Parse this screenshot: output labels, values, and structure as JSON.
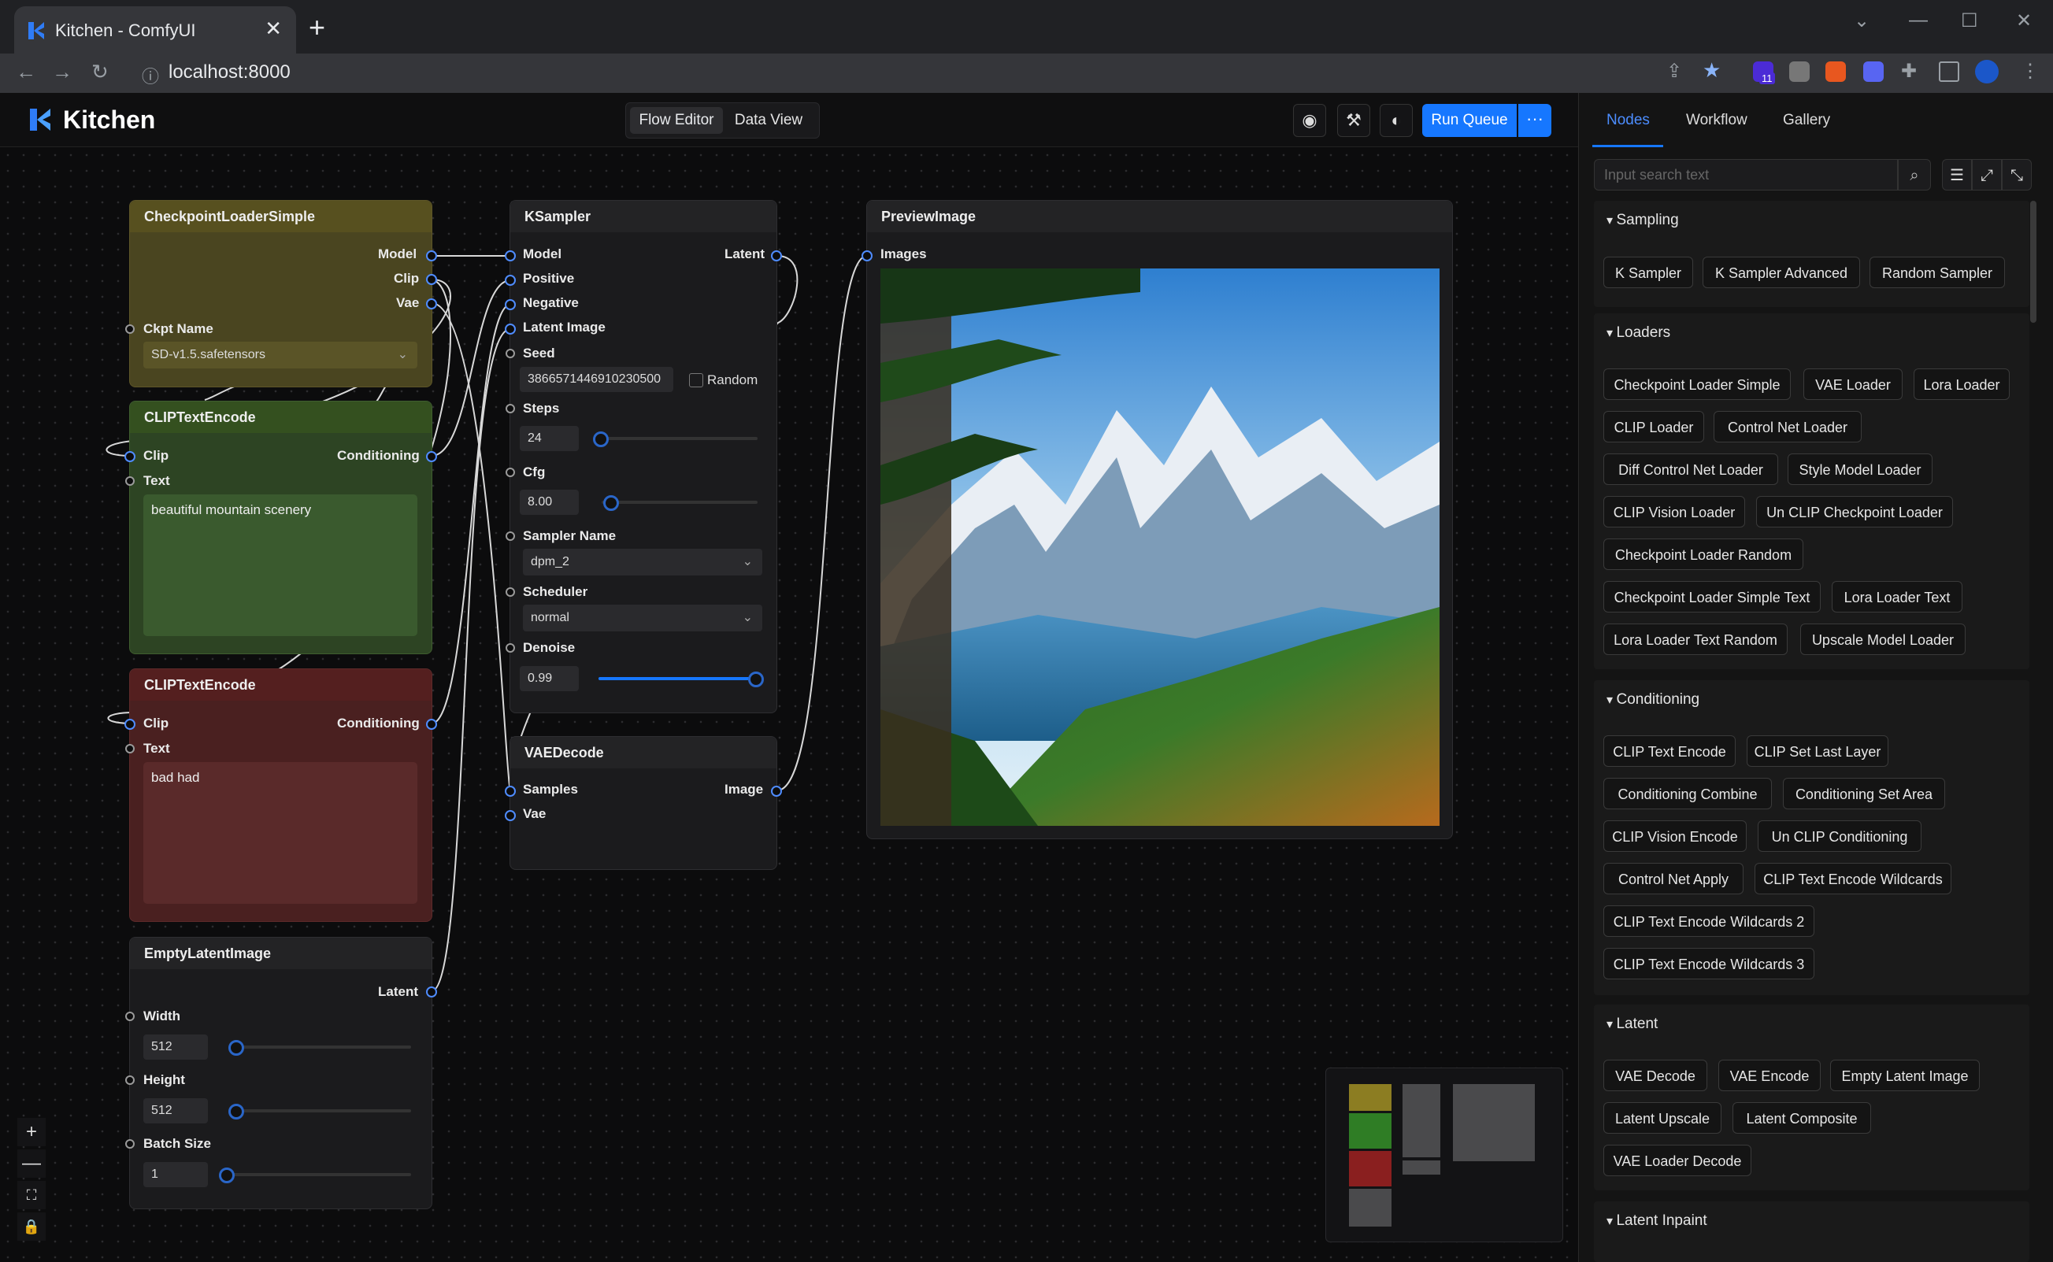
{
  "browser": {
    "tab_title": "Kitchen - ComfyUI",
    "tab_close": "✕",
    "new_tab": "+",
    "url": "localhost:8000",
    "extension_badge": "11"
  },
  "app": {
    "name": "Kitchen",
    "views": [
      "Flow Editor",
      "Data View"
    ],
    "run_queue": "Run Queue",
    "run_more": "···"
  },
  "nodes": {
    "checkpoint": {
      "title": "CheckpointLoaderSimple",
      "outputs": [
        "Model",
        "Clip",
        "Vae"
      ],
      "ckpt_label": "Ckpt Name",
      "ckpt_value": "SD-v1.5.safetensors"
    },
    "clip_pos": {
      "title": "CLIPTextEncode",
      "input": "Clip",
      "output": "Conditioning",
      "text_label": "Text",
      "text": "beautiful mountain scenery"
    },
    "clip_neg": {
      "title": "CLIPTextEncode",
      "input": "Clip",
      "output": "Conditioning",
      "text_label": "Text",
      "text": "bad had"
    },
    "empty_latent": {
      "title": "EmptyLatentImage",
      "output": "Latent",
      "width_label": "Width",
      "width": "512",
      "height_label": "Height",
      "height": "512",
      "batch_label": "Batch Size",
      "batch": "1"
    },
    "ksampler": {
      "title": "KSampler",
      "inputs": [
        "Model",
        "Positive",
        "Negative",
        "Latent Image"
      ],
      "output": "Latent",
      "seed_label": "Seed",
      "seed": "3866571446910230500",
      "random_label": "Random",
      "steps_label": "Steps",
      "steps": "24",
      "cfg_label": "Cfg",
      "cfg": "8.00",
      "sampler_label": "Sampler Name",
      "sampler": "dpm_2",
      "scheduler_label": "Scheduler",
      "scheduler": "normal",
      "denoise_label": "Denoise",
      "denoise": "0.99"
    },
    "vae_decode": {
      "title": "VAEDecode",
      "inputs": [
        "Samples",
        "Vae"
      ],
      "output": "Image"
    },
    "preview": {
      "title": "PreviewImage",
      "input": "Images"
    }
  },
  "panel": {
    "tabs": [
      "Nodes",
      "Workflow",
      "Gallery"
    ],
    "search_placeholder": "Input search text",
    "categories": [
      {
        "title": "Sampling",
        "items": [
          "K Sampler",
          "K Sampler Advanced",
          "Random Sampler"
        ]
      },
      {
        "title": "Loaders",
        "items": [
          "Checkpoint Loader Simple",
          "VAE Loader",
          "Lora Loader",
          "CLIP Loader",
          "Control Net Loader",
          "Diff Control Net Loader",
          "Style Model Loader",
          "CLIP Vision Loader",
          "Un CLIP Checkpoint Loader",
          "Checkpoint Loader Random",
          "Checkpoint Loader Simple Text",
          "Lora Loader Text",
          "Lora Loader Text Random",
          "Upscale Model Loader"
        ]
      },
      {
        "title": "Conditioning",
        "items": [
          "CLIP Text Encode",
          "CLIP Set Last Layer",
          "Conditioning Combine",
          "Conditioning Set Area",
          "CLIP Vision Encode",
          "Un CLIP Conditioning",
          "Control Net Apply",
          "CLIP Text Encode Wildcards",
          "CLIP Text Encode Wildcards 2",
          "CLIP Text Encode Wildcards 3"
        ]
      },
      {
        "title": "Latent",
        "items": [
          "VAE Decode",
          "VAE Encode",
          "Empty Latent Image",
          "Latent Upscale",
          "Latent Composite",
          "VAE Loader Decode"
        ]
      },
      {
        "title": "Latent Inpaint",
        "items": []
      }
    ]
  },
  "colors": {
    "accent": "#1677ff",
    "checkpoint_node": "#4a4520",
    "clip_pos_node": "#2d4423",
    "clip_neg_node": "#4a2020",
    "default_node": "#1b1b1d"
  }
}
